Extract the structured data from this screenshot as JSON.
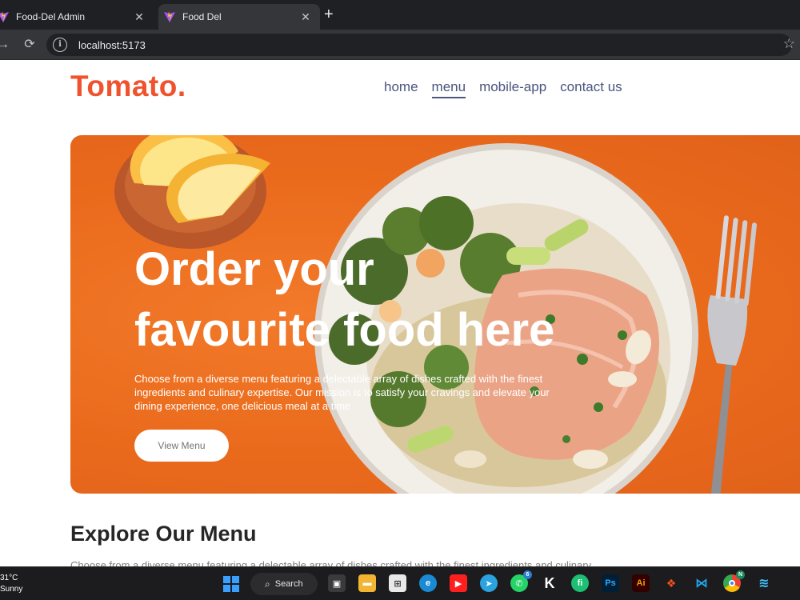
{
  "browser": {
    "tabs": [
      {
        "title": "Food-Del Admin",
        "active": false
      },
      {
        "title": "Food Del",
        "active": true
      }
    ],
    "url": "localhost:5173",
    "icons": {
      "back": "arrow-left-icon",
      "reload": "reload-icon",
      "info": "info-icon",
      "bookmark": "star-icon",
      "new_tab": "plus-icon",
      "close": "close-icon"
    }
  },
  "site": {
    "logo": "Tomato.",
    "nav": [
      {
        "label": "home",
        "active": false
      },
      {
        "label": "menu",
        "active": true
      },
      {
        "label": "mobile-app",
        "active": false
      },
      {
        "label": "contact us",
        "active": false
      }
    ]
  },
  "hero": {
    "title_line1": "Order your",
    "title_line2": "favourite food here",
    "description": "Choose from a diverse menu featuring a delectable array of dishes crafted with the finest ingredients and culinary expertise. Our mission is to satisfy your cravings and elevate your dining experience, one delicious meal at a time",
    "button": "View Menu"
  },
  "explore": {
    "title": "Explore Our Menu",
    "description": "Choose from a diverse menu featuring a delectable array of dishes crafted with the finest ingredients and culinary"
  },
  "taskbar": {
    "weather_temp": "31°C",
    "weather_text": "Sunny",
    "search_label": "Search",
    "whatsapp_badge": "6",
    "chrome_badge": "N",
    "apps": [
      "start-icon",
      "search-icon",
      "task-view-icon",
      "file-explorer-icon",
      "microsoft-store-icon",
      "edge-icon",
      "youtube-icon",
      "telegram-icon",
      "whatsapp-icon",
      "klack-icon",
      "fiverr-icon",
      "photoshop-icon",
      "illustrator-icon",
      "figma-icon",
      "vscode-icon",
      "chrome-icon",
      "app-icon"
    ]
  },
  "colors": {
    "brand": "#f0522d",
    "nav_text": "#49557e",
    "hero_bg": "#ea6a1c",
    "chrome_dark": "#1f2023"
  }
}
